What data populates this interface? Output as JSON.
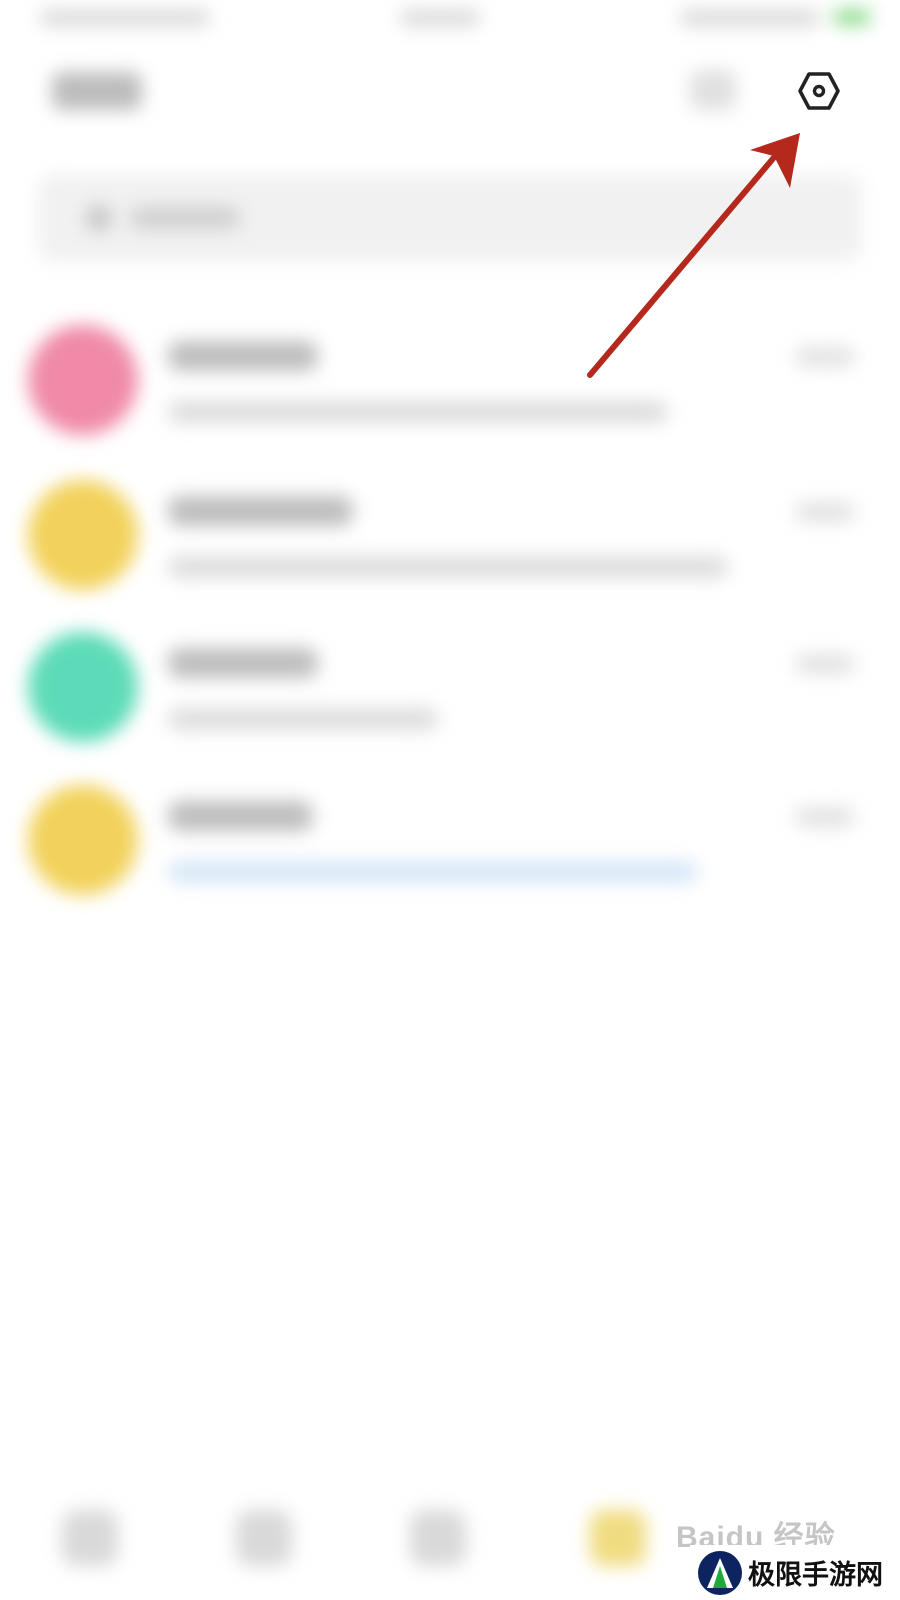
{
  "header": {
    "settings_icon": "hexagon-settings-icon"
  },
  "accent_colors": {
    "arrow": "#b5281c",
    "avatar_pink": "#f08aa8",
    "avatar_yellow": "#f2d25c",
    "avatar_green": "#5ddbb8"
  },
  "conversations": [
    {
      "avatar_color": "#f08aa8"
    },
    {
      "avatar_color": "#f2d25c"
    },
    {
      "avatar_color": "#5ddbb8"
    },
    {
      "avatar_color": "#f2d25c"
    }
  ],
  "watermark": {
    "baidu": "Baidu 经验",
    "site_name": "极限手游网"
  }
}
